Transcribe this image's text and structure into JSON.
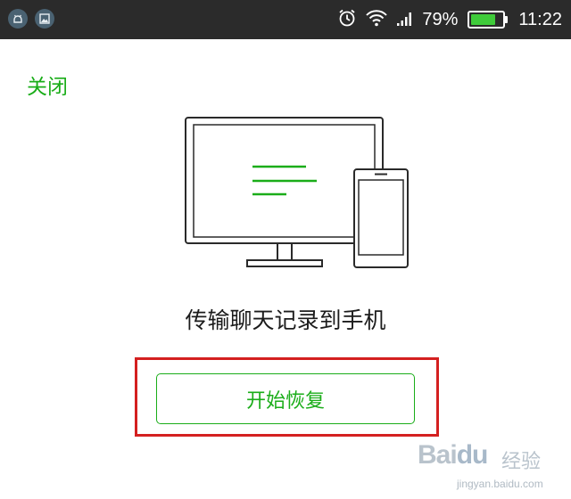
{
  "status_bar": {
    "notification_icons": [
      "android-head-icon",
      "image-icon"
    ],
    "system_icons": [
      "alarm-clock-icon",
      "wifi-icon",
      "cell-signal-icon"
    ],
    "battery_percent": "79%",
    "battery_level": 0.79,
    "time": "11:22"
  },
  "header": {
    "close_label": "关闭"
  },
  "illustration": {
    "icon": "computer-to-phone-icon",
    "accent_color": "#1aad19"
  },
  "main": {
    "headline": "传输聊天记录到手机",
    "restore_button_label": "开始恢复",
    "highlight_color": "#d42020"
  },
  "watermark": {
    "logo_text": "Bai",
    "logo_suffix": "du",
    "jingyan": "经验",
    "url": "jingyan.baidu.com"
  }
}
